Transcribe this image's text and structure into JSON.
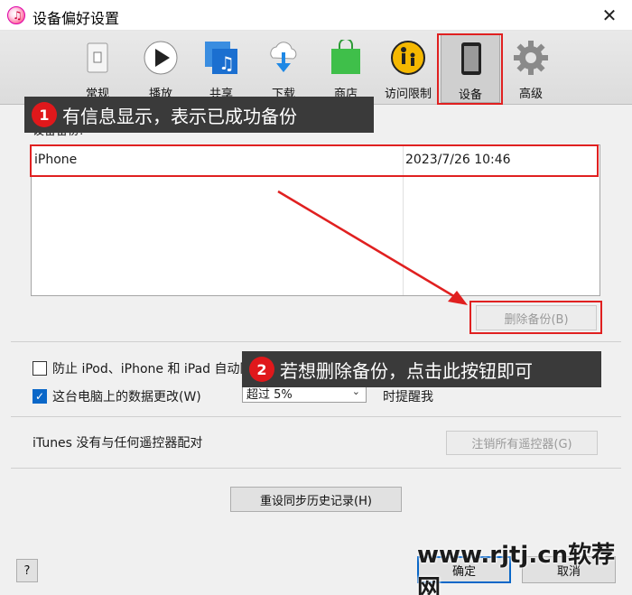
{
  "window": {
    "title": "设备偏好设置",
    "app_icon_glyph": "♫",
    "close_glyph": "✕"
  },
  "toolbar": {
    "items": [
      {
        "label": "常规",
        "icon": "switch-icon"
      },
      {
        "label": "播放",
        "icon": "play-icon"
      },
      {
        "label": "共享",
        "icon": "music-share-icon"
      },
      {
        "label": "下载",
        "icon": "cloud-download-icon"
      },
      {
        "label": "商店",
        "icon": "store-bag-icon"
      },
      {
        "label": "访问限制",
        "icon": "parental-control-icon"
      },
      {
        "label": "设备",
        "icon": "device-icon",
        "selected": true
      },
      {
        "label": "高级",
        "icon": "gear-icon"
      }
    ]
  },
  "annotations": [
    {
      "number": "1",
      "text": "有信息显示，表示已成功备份"
    },
    {
      "number": "2",
      "text": "若想删除备份，点击此按钮即可"
    }
  ],
  "backups": {
    "label": "设备备份:",
    "rows": [
      {
        "name": "iPhone",
        "date": "2023/7/26 10:46"
      }
    ],
    "delete_button": "删除备份(B)"
  },
  "options": {
    "prevent_sync": {
      "label": "防止 iPod、iPhone 和 iPad 自动同步(P)",
      "checked": false
    },
    "warn_changes": {
      "label": "这台电脑上的数据更改(W)",
      "checked": true
    },
    "threshold_select": "超过 5%",
    "threshold_suffix": "时提醒我"
  },
  "remotes": {
    "label": "iTunes 没有与任何遥控器配对",
    "button": "注销所有遥控器(G)"
  },
  "reset_history_button": "重设同步历史记录(H)",
  "footer": {
    "help": "?",
    "ok": "确定",
    "cancel": "取消"
  },
  "watermark": "www.rjtj.cn软荐网",
  "colors": {
    "highlight": "#e02020",
    "annotation_bg": "#3a3a3a",
    "checkbox_accent": "#0a67c8"
  }
}
